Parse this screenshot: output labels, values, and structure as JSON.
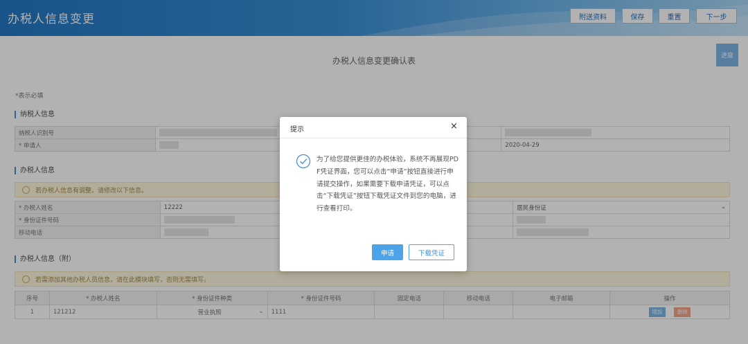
{
  "app": {
    "title": "办税人信息变更"
  },
  "toolbar": {
    "attach_label": "附送资料",
    "save_label": "保存",
    "reset_label": "重置",
    "next_label": "下一步"
  },
  "form": {
    "title": "办税人信息变更确认表",
    "progress_label": "进度",
    "required_note": "*表示必填"
  },
  "taxpayer": {
    "section_title": "纳税人信息",
    "id_label": "纳税人识别号",
    "applicant_label": "* 申请人",
    "date_value": "2020-04-29"
  },
  "agent": {
    "section_title": "办税人信息",
    "notice": "若办税人信息有调整，请修改以下信息。",
    "name_label": "* 办税人姓名",
    "name_value": "12222",
    "idno_label": "* 身份证件号码",
    "phone_label": "移动电话",
    "idtype_value": "居民身份证"
  },
  "agent_extra": {
    "section_title": "办税人信息（附）",
    "notice": "若需添加其他办税人员信息，请在此模块填写，否则无需填写。",
    "columns": [
      "序号",
      "* 办税人姓名",
      "* 身份证件种类",
      "* 身份证件号码",
      "固定电话",
      "移动电话",
      "电子邮箱",
      "操作"
    ],
    "rows": [
      {
        "index": "1",
        "name": "121212",
        "id_type": "营业执照",
        "id_no": "1111",
        "btn_add": "增加",
        "btn_del": "删除"
      }
    ]
  },
  "dialog": {
    "title": "提示",
    "close": "×",
    "message": "为了给您提供更佳的办税体验，系统不再展现PDF凭证界面，您可以点击“申请”按钮直接进行申请提交操作，如果需要下载申请凭证，可以点击“下载凭证”按钮下载凭证文件到您的电脑，进行查看打印。",
    "apply_label": "申请",
    "download_label": "下载凭证"
  },
  "colors": {
    "header": "#2478c4",
    "primary": "#4da3e8",
    "danger": "#f08a5d"
  }
}
